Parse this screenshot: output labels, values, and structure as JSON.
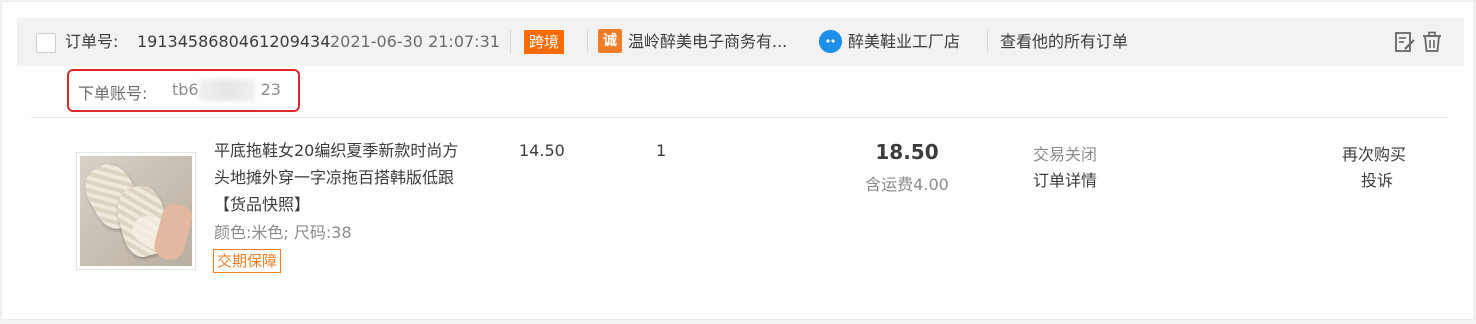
{
  "header": {
    "order_label": "订单号:",
    "order_no": "1913458680461209434",
    "order_time": "2021-06-30 21:07:31",
    "cross_border_badge": "跨境",
    "cheng_badge": "诚",
    "company_name": "温岭醉美电子商务有...",
    "shop_name": "醉美鞋业工厂店",
    "view_all_orders": "查看他的所有订单",
    "accent_color": "#ff6a00"
  },
  "account": {
    "label": "下单账号:",
    "value_start": "tb6",
    "value_end": "23",
    "highlight_color": "#e0282e"
  },
  "item": {
    "title": "平底拖鞋女20编织夏季新款时尚方头地摊外穿一字凉拖百搭韩版低跟",
    "snapshot": "【货品快照】",
    "sku": "颜色:米色; 尺码:38",
    "guarantee": "交期保障",
    "unit_price": "14.50",
    "quantity": "1",
    "total": "18.50",
    "shipping": "含运费4.00",
    "status": "交易关闭",
    "detail_link": "订单详情",
    "rebuy": "再次购买",
    "complain": "投诉"
  },
  "icons": {
    "edit": "edit-note-icon",
    "delete": "trash-icon",
    "chat": "chat-bubble-icon",
    "cheng": "cheng-trust-icon"
  }
}
